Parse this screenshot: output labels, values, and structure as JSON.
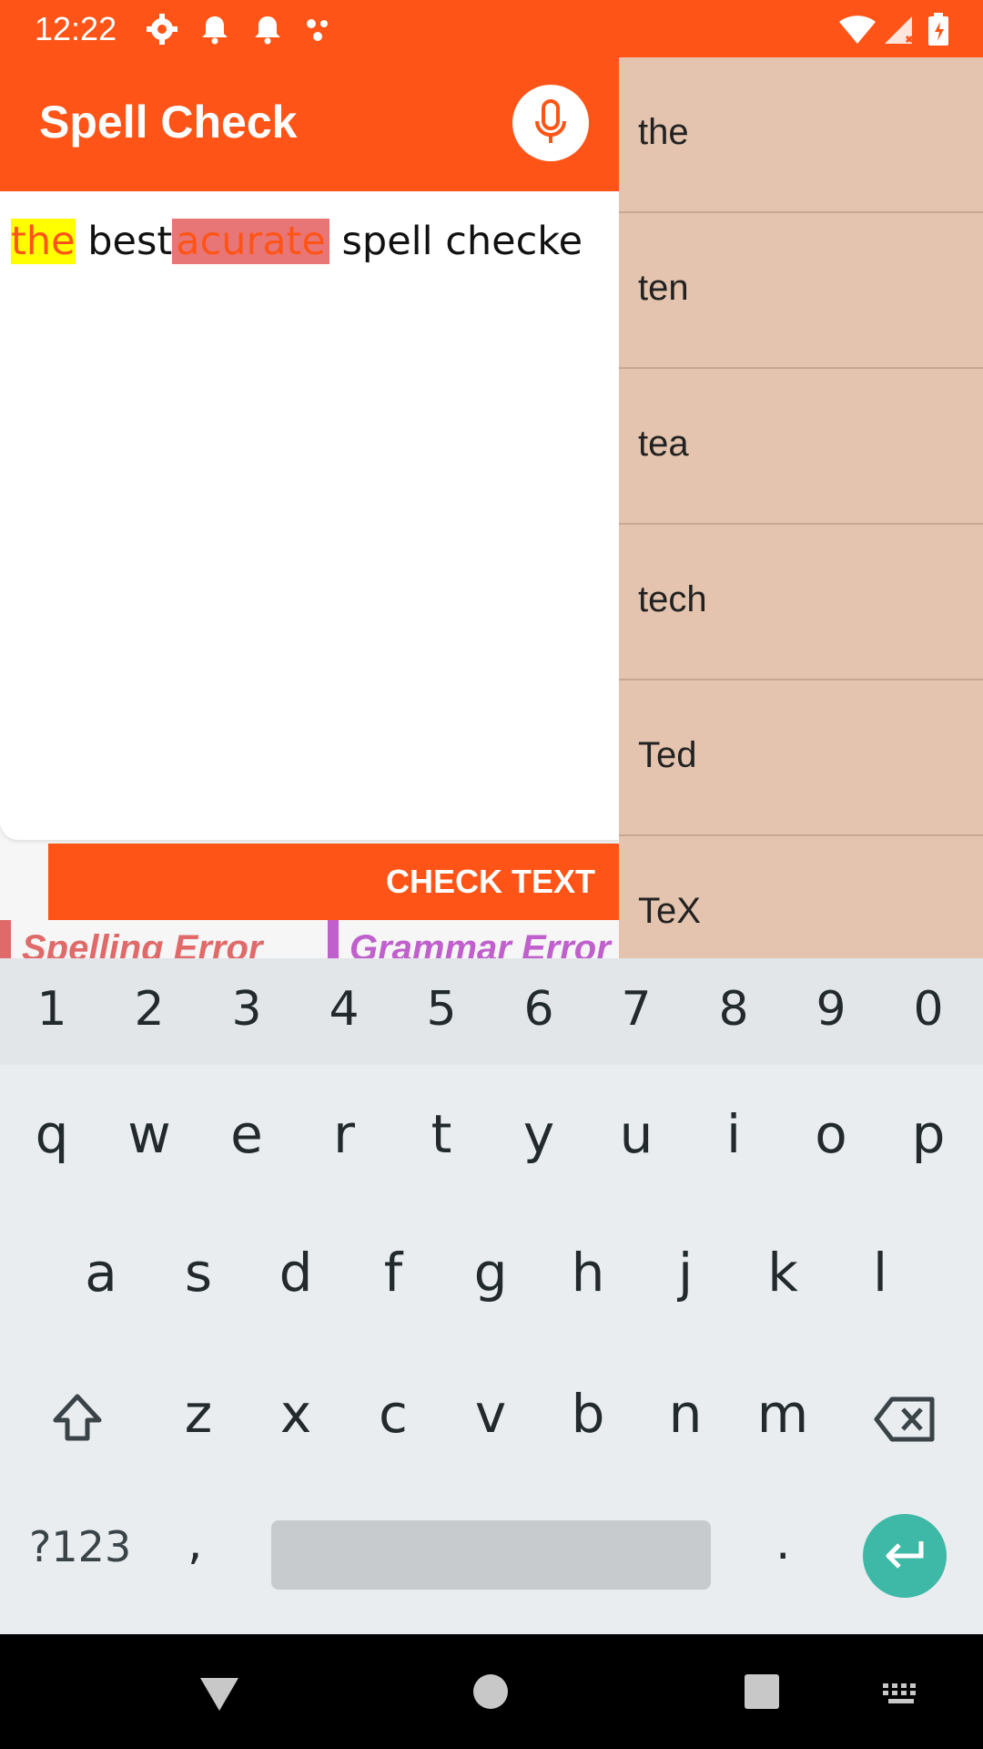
{
  "status_bar": {
    "time": "12:22",
    "icons": [
      "settings-icon",
      "notification-icon",
      "notification-icon",
      "dots-icon",
      "wifi-icon",
      "signal-icon",
      "battery-icon"
    ]
  },
  "app_bar": {
    "title": "Spell Check",
    "mic_icon": "microphone-icon"
  },
  "editor": {
    "words": [
      {
        "text": "the",
        "state": "warning"
      },
      {
        "text": " best",
        "state": "normal"
      },
      {
        "text": "acurate",
        "state": "spelling-error"
      },
      {
        "text": " spell checke",
        "state": "normal"
      }
    ]
  },
  "check_button": {
    "label": "CHECK TEXT"
  },
  "legend": {
    "spelling": "Spelling Error",
    "grammar": "Grammar Error"
  },
  "suggestions": [
    "the",
    "ten",
    "tea",
    "tech",
    "Ted",
    "TeX"
  ],
  "keyboard": {
    "numbers": [
      "1",
      "2",
      "3",
      "4",
      "5",
      "6",
      "7",
      "8",
      "9",
      "0"
    ],
    "row1": [
      "q",
      "w",
      "e",
      "r",
      "t",
      "y",
      "u",
      "i",
      "o",
      "p"
    ],
    "row2": [
      "a",
      "s",
      "d",
      "f",
      "g",
      "h",
      "j",
      "k",
      "l"
    ],
    "row3": [
      "z",
      "x",
      "c",
      "v",
      "b",
      "n",
      "m"
    ],
    "symbols_label": "?123",
    "comma": ",",
    "period": "."
  },
  "colors": {
    "brand": "#ff5417",
    "suggestion_bg": "#e4c4ae",
    "warning_highlight": "#ffff00",
    "spelling_highlight": "#e87676",
    "grammar_color": "#c060cc",
    "enter_key": "#3eb8a7"
  }
}
